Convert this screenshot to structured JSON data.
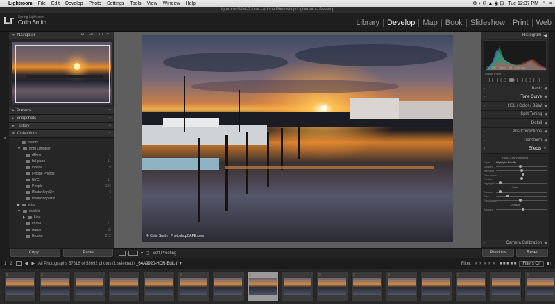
{
  "menubar": {
    "apple": "",
    "app": "Lightroom",
    "items": [
      "File",
      "Edit",
      "Develop",
      "Photo",
      "Settings",
      "Tools",
      "View",
      "Window",
      "Help"
    ],
    "time": "Tue 12:37 PM"
  },
  "window_title": "lightroom5-full-2.lrcat - Adobe Photoshop Lightroom - Develop",
  "identity": {
    "logo": "Lr",
    "subtitle": "Spring Lightroom",
    "name": "Colin Smith"
  },
  "modules": [
    "Library",
    "Develop",
    "Map",
    "Book",
    "Slideshow",
    "Print",
    "Web"
  ],
  "active_module": "Develop",
  "left_panel": {
    "navigator": {
      "label": "Navigator",
      "options": [
        "FIT",
        "FILL",
        "1:1",
        "3:1"
      ]
    },
    "sections": [
      "Presets",
      "Snapshots",
      "History",
      "Collections"
    ],
    "collections": [
      {
        "name": "events",
        "count": ""
      },
      {
        "name": "from Lrmobile",
        "count": ""
      },
      {
        "name": "dkkno",
        "count": "1"
      },
      {
        "name": "fall-pano",
        "count": "11"
      },
      {
        "name": "iphone",
        "count": "9"
      },
      {
        "name": "iPhone Photos",
        "count": "1"
      },
      {
        "name": "NYC",
        "count": "11"
      },
      {
        "name": "People",
        "count": "136"
      },
      {
        "name": "Photoshop Fix",
        "count": "3"
      },
      {
        "name": "Photoshop Mix",
        "count": "2"
      },
      {
        "name": "misc",
        "count": ""
      },
      {
        "name": "models",
        "count": ""
      },
      {
        "name": "Lina",
        "count": ""
      },
      {
        "name": "chase",
        "count": "21"
      },
      {
        "name": "Aaron",
        "count": "15"
      },
      {
        "name": "Brooke",
        "count": "212"
      }
    ],
    "copy_label": "Copy...",
    "paste_label": "Paste"
  },
  "photo": {
    "credit": "© Colin Smith | PhotoshopCAFE.com"
  },
  "toolbar": {
    "soft_proofing": "Soft Proofing"
  },
  "right_panel": {
    "histogram_label": "Histogram",
    "histo_values": [
      "ISO 400",
      "14mm",
      "f/8",
      "1/30 sec"
    ],
    "original_photo": "Original Photo",
    "sections": [
      "Basic",
      "Tone Curve",
      "HSL / Color / B&W",
      "Split Toning",
      "Detail",
      "Lens Corrections",
      "Transform",
      "Effects"
    ],
    "effects": {
      "vignette_title": "Post-Crop Vignetting",
      "style_label": "Style",
      "style_value": "Highlight Priority",
      "vignette_rows": [
        "Amount",
        "Midpoint",
        "Roundness",
        "Feather",
        "Highlights"
      ],
      "grain_title": "Grain",
      "grain_rows": [
        "Amount",
        "Size",
        "Roughness"
      ],
      "dehaze_title": "Dehaze",
      "dehaze_rows": [
        "Amount"
      ]
    },
    "next_section": "Camera Calibration",
    "previous_label": "Previous",
    "reset_label": "Reset"
  },
  "filmstrip_bar": {
    "pages": [
      "1",
      "2"
    ],
    "source": "All Photographs",
    "count": "57616 of 58692 photos /1 selected /",
    "file": "_64A9920-HDR-Edit.tif",
    "filter_label": "Filter:",
    "filters_off": "Filters Off"
  },
  "filmstrip": {
    "thumbs": [
      "2",
      "3",
      "",
      "",
      "",
      "3",
      "",
      "3",
      "",
      "3",
      "3",
      "3",
      "",
      "3",
      "",
      "3"
    ],
    "selected_index": 7
  }
}
